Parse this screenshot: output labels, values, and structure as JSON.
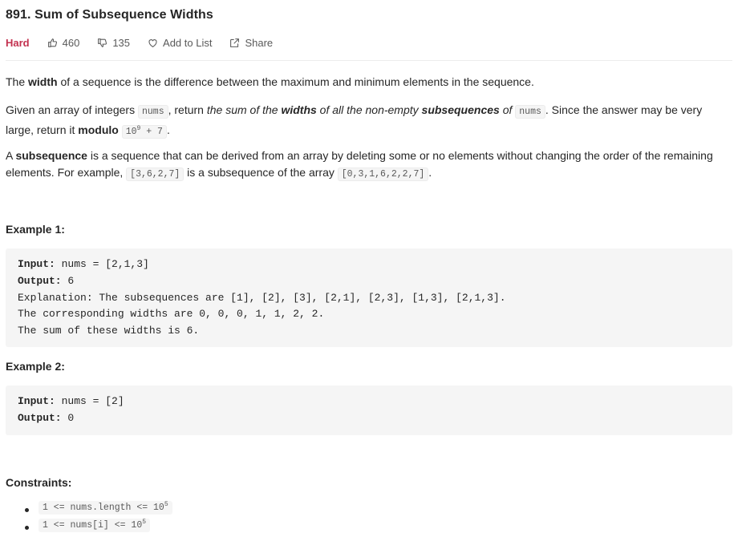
{
  "problem": {
    "title": "891. Sum of Subsequence Widths",
    "difficulty": "Hard",
    "likes": "460",
    "dislikes": "135",
    "add_to_list": "Add to List",
    "share": "Share"
  },
  "description": {
    "p1_a": "The ",
    "p1_b": "width",
    "p1_c": " of a sequence is the difference between the maximum and minimum elements in the sequence.",
    "p2_a": "Given an array of integers ",
    "p2_code1": "nums",
    "p2_b": ", return ",
    "p2_i1": "the sum of the ",
    "p2_bi1": "widths",
    "p2_i2": " of all the non-empty ",
    "p2_bi2": "subsequences",
    "p2_i3": " of ",
    "p2_code2": "nums",
    "p2_c": ". Since the answer may be very large, return it ",
    "p2_bold": "modulo",
    "p2_code3_base": "10",
    "p2_code3_exp": "9",
    "p2_code3_rest": " + 7",
    "p2_end": ".",
    "p3_a": "A ",
    "p3_b": "subsequence",
    "p3_c": " is a sequence that can be derived from an array by deleting some or no elements without changing the order of the remaining elements. For example, ",
    "p3_code1": "[3,6,2,7]",
    "p3_d": " is a subsequence of the array ",
    "p3_code2": "[0,3,1,6,2,2,7]",
    "p3_end": "."
  },
  "example1": {
    "heading": "Example 1:",
    "input_label": "Input:",
    "input_value": " nums = [2,1,3]",
    "output_label": "Output:",
    "output_value": " 6",
    "line3": "Explanation: The subsequences are [1], [2], [3], [2,1], [2,3], [1,3], [2,1,3].",
    "line4": "The corresponding widths are 0, 0, 0, 1, 1, 2, 2.",
    "line5": "The sum of these widths is 6."
  },
  "example2": {
    "heading": "Example 2:",
    "input_label": "Input:",
    "input_value": " nums = [2]",
    "output_label": "Output:",
    "output_value": " 0"
  },
  "constraints": {
    "heading": "Constraints:",
    "c1_base": "1 <= nums.length <= 10",
    "c1_exp": "5",
    "c2_base": "1 <= nums[i] <= 10",
    "c2_exp": "5"
  }
}
